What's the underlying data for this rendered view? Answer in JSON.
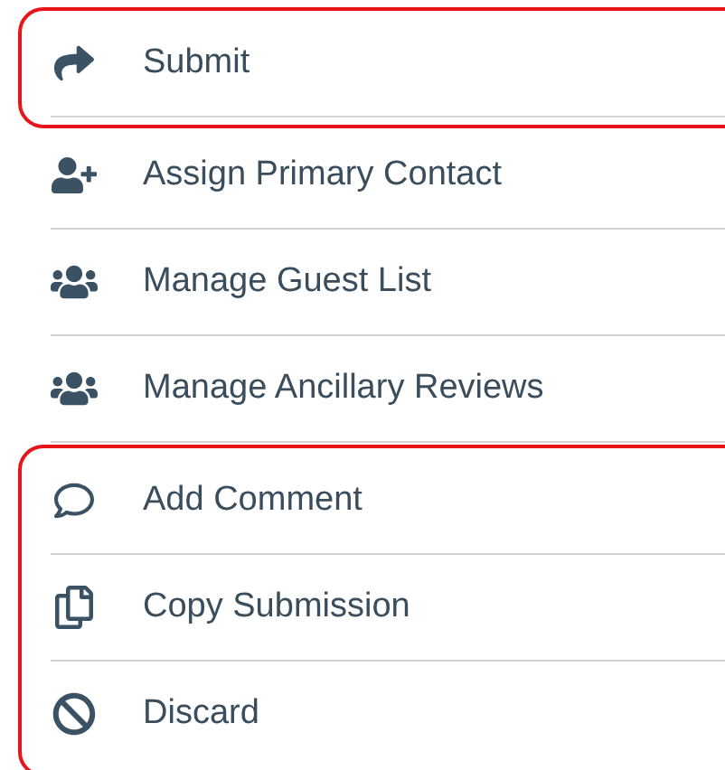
{
  "groups": [
    {
      "highlighted": true,
      "items": [
        {
          "label": "Submit"
        }
      ]
    },
    {
      "highlighted": false,
      "items": [
        {
          "label": "Assign Primary Contact"
        },
        {
          "label": "Manage Guest List"
        },
        {
          "label": "Manage Ancillary Reviews"
        }
      ]
    },
    {
      "highlighted": true,
      "items": [
        {
          "label": "Add Comment"
        },
        {
          "label": "Copy Submission"
        },
        {
          "label": "Discard"
        }
      ]
    }
  ]
}
